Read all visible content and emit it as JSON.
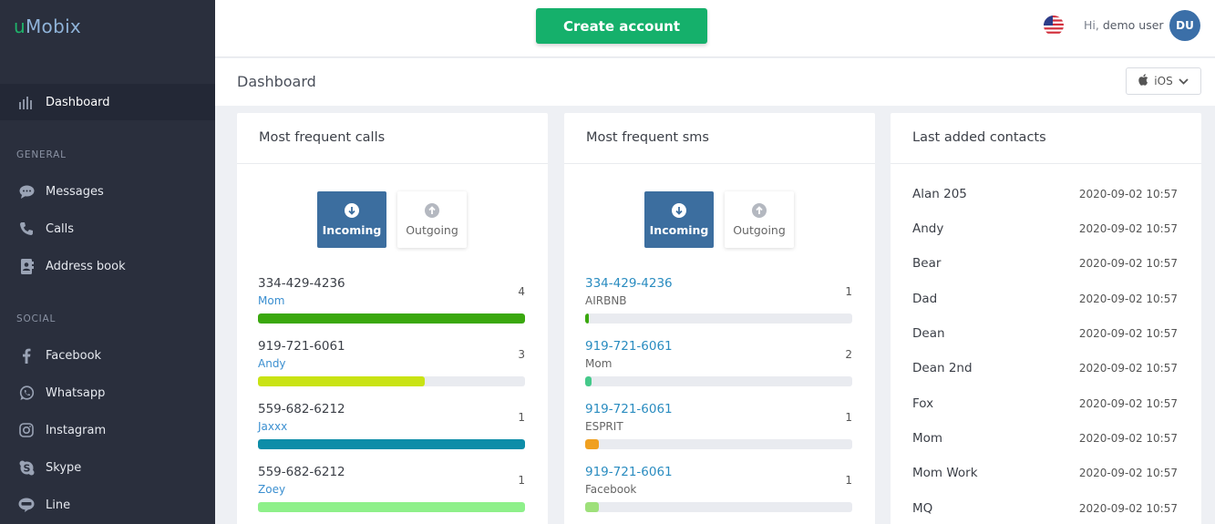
{
  "brand": {
    "u": "u",
    "rest": "Mobix"
  },
  "sidebar": {
    "active": {
      "label": "Dashboard"
    },
    "general_title": "GENERAL",
    "general": [
      {
        "label": "Messages",
        "icon": "chat-icon"
      },
      {
        "label": "Calls",
        "icon": "phone-icon"
      },
      {
        "label": "Address book",
        "icon": "address-book-icon"
      }
    ],
    "social_title": "SOCIAL",
    "social": [
      {
        "label": "Facebook",
        "icon": "facebook-icon"
      },
      {
        "label": "Whatsapp",
        "icon": "whatsapp-icon"
      },
      {
        "label": "Instagram",
        "icon": "instagram-icon"
      },
      {
        "label": "Skype",
        "icon": "skype-icon"
      },
      {
        "label": "Line",
        "icon": "line-icon"
      }
    ]
  },
  "topbar": {
    "create_label": "Create account",
    "greeting": "Hi,",
    "username": "demo user",
    "avatar_initials": "DU"
  },
  "dashboard": {
    "title": "Dashboard",
    "os_label": "iOS"
  },
  "calls": {
    "title": "Most frequent calls",
    "incoming_label": "Incoming",
    "outgoing_label": "Outgoing",
    "items": [
      {
        "phone": "334-429-4236",
        "name": "Mom",
        "count": "4",
        "fraction": 1.0,
        "color": "#3aa80e"
      },
      {
        "phone": "919-721-6061",
        "name": "Andy",
        "count": "3",
        "fraction": 0.625,
        "color": "#c9e314"
      },
      {
        "phone": "559-682-6212",
        "name": "Jaxxx",
        "count": "1",
        "fraction": 1.0,
        "color": "#0e8da8"
      },
      {
        "phone": "559-682-6212",
        "name": "Zoey",
        "count": "1",
        "fraction": 1.0,
        "color": "#8ef08a"
      }
    ]
  },
  "sms": {
    "title": "Most frequent sms",
    "incoming_label": "Incoming",
    "outgoing_label": "Outgoing",
    "items": [
      {
        "phone": "334-429-4236",
        "name": "AIRBNB",
        "count": "1",
        "fraction": 0.015,
        "color": "#3aa80e"
      },
      {
        "phone": "919-721-6061",
        "name": "Mom",
        "count": "2",
        "fraction": 0.025,
        "color": "#45c98a"
      },
      {
        "phone": "919-721-6061",
        "name": "ESPRIT",
        "count": "1",
        "fraction": 0.05,
        "color": "#f0a020"
      },
      {
        "phone": "919-721-6061",
        "name": "Facebook",
        "count": "1",
        "fraction": 0.05,
        "color": "#9ee07a"
      }
    ]
  },
  "contacts": {
    "title": "Last added contacts",
    "items": [
      {
        "name": "Alan 205",
        "date": "2020-09-02 10:57"
      },
      {
        "name": "Andy",
        "date": "2020-09-02 10:57"
      },
      {
        "name": "Bear",
        "date": "2020-09-02 10:57"
      },
      {
        "name": "Dad",
        "date": "2020-09-02 10:57"
      },
      {
        "name": "Dean",
        "date": "2020-09-02 10:57"
      },
      {
        "name": "Dean 2nd",
        "date": "2020-09-02 10:57"
      },
      {
        "name": "Fox",
        "date": "2020-09-02 10:57"
      },
      {
        "name": "Mom",
        "date": "2020-09-02 10:57"
      },
      {
        "name": "Mom Work",
        "date": "2020-09-02 10:57"
      },
      {
        "name": "MQ",
        "date": "2020-09-02 10:57"
      }
    ]
  }
}
